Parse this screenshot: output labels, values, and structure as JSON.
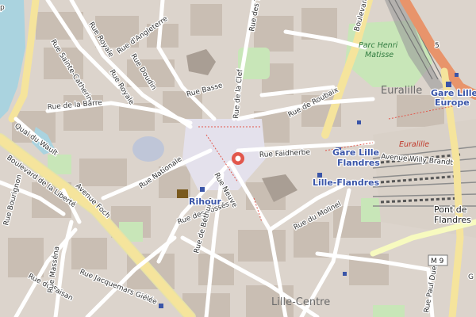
{
  "map": {
    "colors": {
      "background": "#dcd4cc",
      "building": "#c9beb3",
      "road": "#ffffff",
      "primary_road": "#f5e49c",
      "secondary_road": "#f7fabf",
      "motorway": "#e8946b",
      "water": "#aad3df",
      "park": "#c8e6b8",
      "rail": "#9a9a9a",
      "pedestrian": "#e4e1ec",
      "marker": "#e2574c"
    },
    "streets": {
      "rue_des_tours": "Rue des Tours",
      "rue_dangleterre": "Rue d'Angleterre",
      "rue_royale_1": "Rue Royale",
      "rue_royale_2": "Rue Royale",
      "rue_sainte_catherine": "Rue Sainte-Catherine",
      "rue_doudin": "Rue Doudin",
      "rue_basse": "Rue Basse",
      "rue_de_la_clef": "Rue de la Clef",
      "rue_de_roubaix": "Rue de Roubaix",
      "rue_de_la_barre": "Rue de la Barre",
      "quai_du_wault": "Quai du Wault",
      "rue_faidherbe": "Rue Faidherbe",
      "avenue_willy_brandt": "Avenue Willy Brandt",
      "boulevard_de_la_liberte": "Boulevard de la Liberté",
      "rue_bourignon": "Rue Bourignon",
      "avenue_foch": "Avenue Foch",
      "rue_nationale": "Rue Nationale",
      "rue_neuve": "Rue Neuve",
      "rue_des_fosses": "Rue des Fossés",
      "rue_de_bethune": "Rue de Béthune",
      "rue_du_molinel": "Rue du Molinel",
      "rue_du_faisan": "Rue du Faisan",
      "rue_massena": "Rue Masséna",
      "rue_jacquemars_gielee": "Rue Jacquemars Giélée",
      "rue_paul_duez": "Rue Paul Duez",
      "boulevard_edge": "Boulevard"
    },
    "places": {
      "euralille_district": "Euralille",
      "lille_centre": "Lille-Centre",
      "euralille_mall": "Euralille",
      "parc_henri_matisse_line1": "Parc Henri",
      "parc_henri_matisse_line2": "Matisse",
      "pont_de_flandres_line1": "Pont de",
      "pont_de_flandres_line2": "Flandres"
    },
    "pois": {
      "gare_lille_flandres_line1": "Gare Lille",
      "gare_lille_flandres_line2": "Flandres",
      "lille_flandres_metro": "Lille-Flandres",
      "gare_lille_europe_line1": "Gare Lille",
      "gare_lille_europe_line2": "Europe",
      "rihour": "Rihour"
    },
    "shields": {
      "m9": "M 9",
      "five": "5"
    },
    "edge_text": {
      "top_left": "p",
      "right_g": "G"
    }
  }
}
